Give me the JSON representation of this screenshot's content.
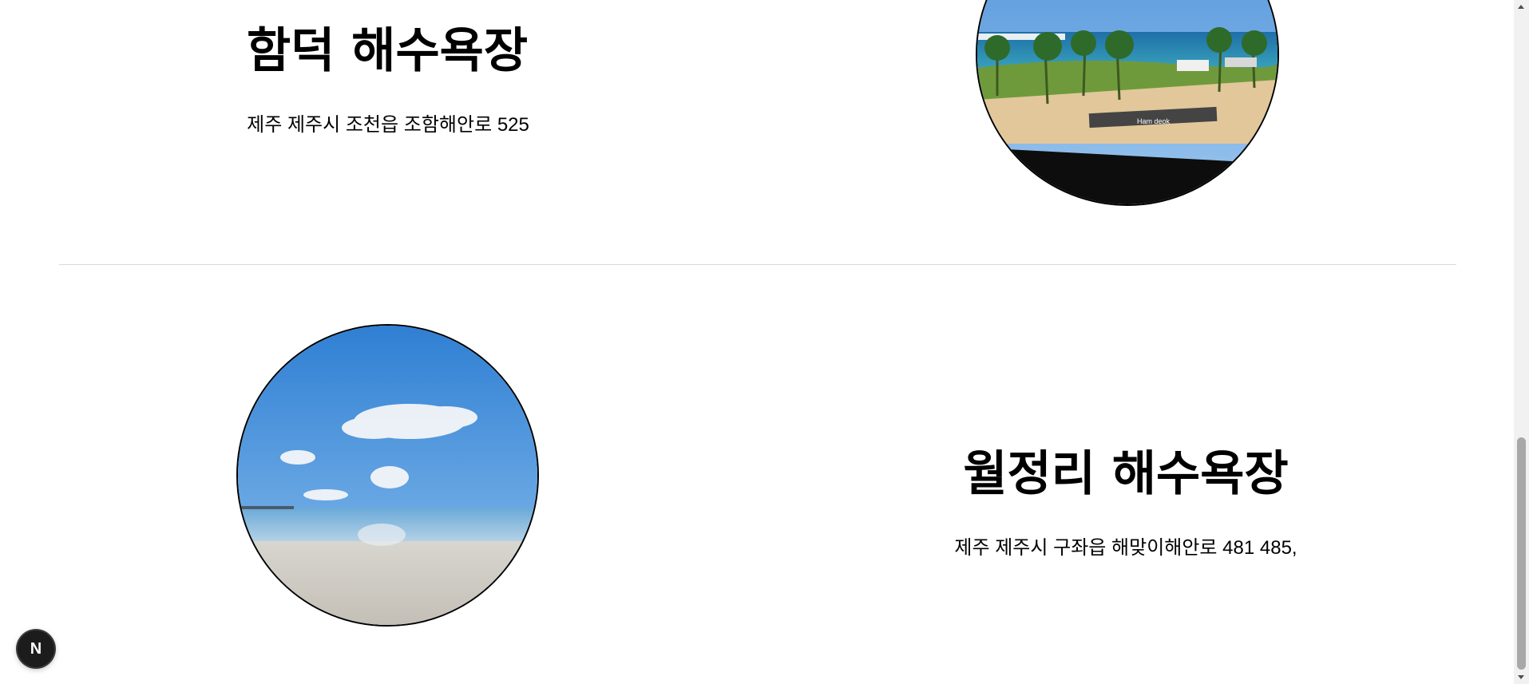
{
  "beaches": [
    {
      "name": "함덕 해수욕장",
      "address": "제주 제주시 조천읍 조함해안로 525",
      "photo_sign": "Ham deok"
    },
    {
      "name": "월정리 해수욕장",
      "address": "제주 제주시 구좌읍 해맞이해안로 481 485,"
    }
  ],
  "badge": {
    "letter": "N"
  }
}
